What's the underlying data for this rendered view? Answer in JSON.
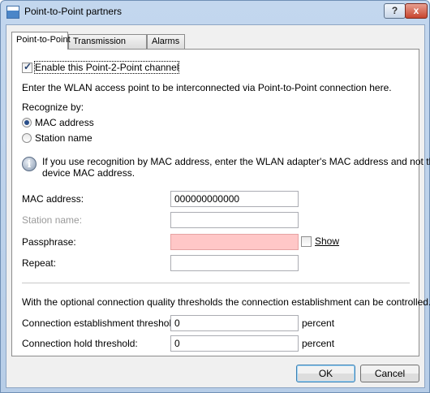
{
  "window": {
    "title": "Point-to-Point partners",
    "help_label": "?",
    "close_label": "x"
  },
  "tabs": [
    {
      "label": "Point-to-Point",
      "active": true
    },
    {
      "label": "Transmission",
      "active": false
    },
    {
      "label": "Alarms",
      "active": false
    }
  ],
  "form": {
    "enable_label": "Enable this Point-2-Point channel",
    "enable_checked": true,
    "intro_text": "Enter the WLAN access point to be interconnected via Point-to-Point connection here.",
    "recognize_label": "Recognize by:",
    "recognize_options": [
      {
        "label": "MAC address",
        "selected": true
      },
      {
        "label": "Station name",
        "selected": false
      }
    ],
    "info_line1": "If you use recognition by MAC address, enter the WLAN adapter's MAC address and not the",
    "info_line2": "device MAC address.",
    "mac_label": "MAC address:",
    "mac_value": "000000000000",
    "station_label": "Station name:",
    "station_value": "",
    "passphrase_label": "Passphrase:",
    "passphrase_value": "",
    "show_label": "Show",
    "show_checked": false,
    "repeat_label": "Repeat:",
    "repeat_value": "",
    "threshold_text": "With the optional connection quality thresholds the connection establishment can be controlled.",
    "establish_label": "Connection establishment threshold:",
    "establish_value": "0",
    "establish_unit": "percent",
    "hold_label": "Connection hold threshold:",
    "hold_value": "0",
    "hold_unit": "percent"
  },
  "buttons": {
    "ok_label": "OK",
    "cancel_label": "Cancel"
  },
  "colors": {
    "passphrase_invalid_bg": "#ffc7c7"
  }
}
